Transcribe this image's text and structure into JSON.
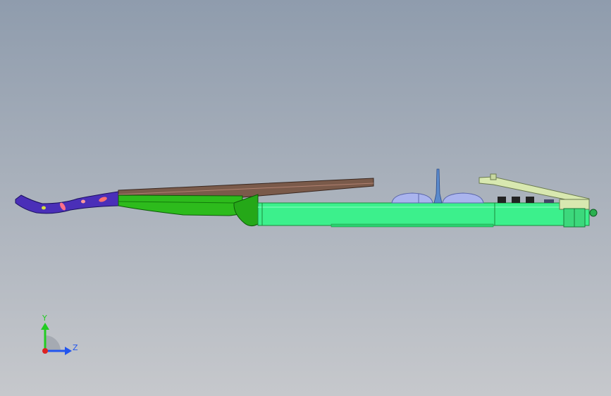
{
  "view": {
    "background_top": "#8f9cad",
    "background_bottom": "#c6c8cc"
  },
  "model": {
    "scroll_color": "#4a2fb8",
    "neck_color": "#2dbb1c",
    "fingerboard_color": "#7a5a4a",
    "body_color": "#3cf08c",
    "tailpiece_color": "#d8e8b0",
    "dome_color": "#aab4ee"
  },
  "triad": {
    "y_label": "Y",
    "z_label": "Z",
    "y_color": "#22cc22",
    "z_color": "#2255ee",
    "x_color": "#dd2222"
  }
}
